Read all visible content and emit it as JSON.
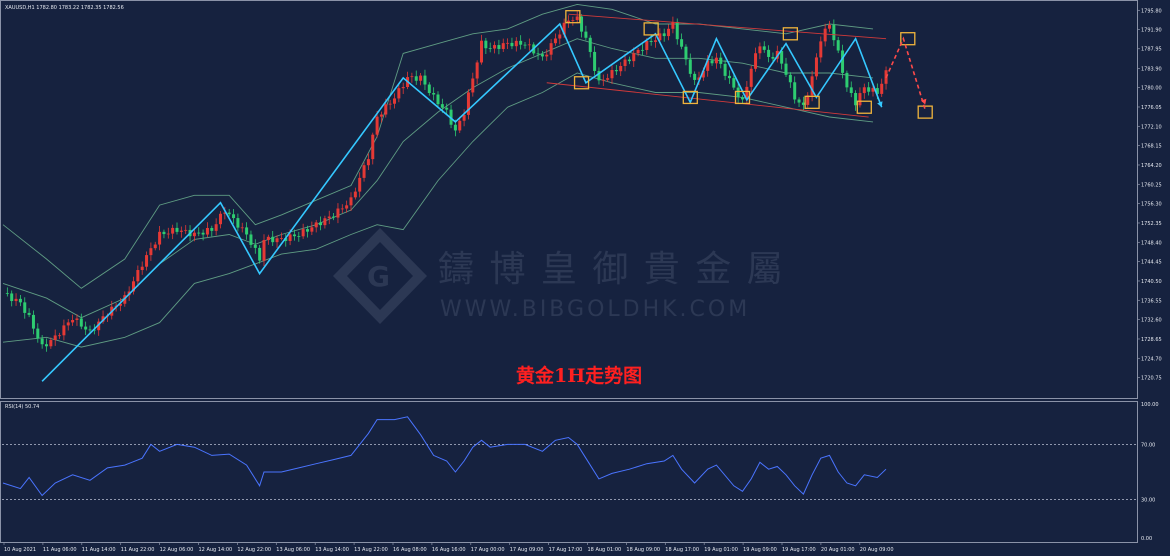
{
  "symbol_header": "XAUUSD,H1  1782.80 1783.22 1782.35 1782.56",
  "rsi_header": "RSI(14) 50.74",
  "annotation": "黄金1H走势图",
  "watermark": {
    "cn": "鑄 博 皇 御 貴 金 屬",
    "url": "WWW.BIBGOLDHK.COM"
  },
  "colors": {
    "background": "#16223f",
    "up": "#e53935",
    "down": "#2ecc71",
    "bollinger": "#5f9c83",
    "zigzag": "#35c8ff",
    "channel": "#d13a3a",
    "box": "#f0b43c",
    "forecast": "#ff4a4a",
    "rsi": "#4a74ff",
    "text": "#e6e9f0"
  },
  "chart_data": [
    {
      "type": "candlestick",
      "title": "",
      "y_ticks": [
        "1795.80",
        "1791.90",
        "1787.95",
        "1783.90",
        "1780.00",
        "1776.05",
        "1772.10",
        "1768.15",
        "1764.20",
        "1760.25",
        "1756.30",
        "1752.35",
        "1748.40",
        "1744.45",
        "1740.50",
        "1736.55",
        "1732.60",
        "1728.65",
        "1724.70",
        "1720.75"
      ],
      "x_ticks": [
        "10 Aug 2021",
        "11 Aug 06:00",
        "11 Aug 14:00",
        "11 Aug 22:00",
        "12 Aug 06:00",
        "12 Aug 14:00",
        "12 Aug 22:00",
        "13 Aug 06:00",
        "13 Aug 14:00",
        "13 Aug 22:00",
        "16 Aug 08:00",
        "16 Aug 16:00",
        "17 Aug 00:00",
        "17 Aug 09:00",
        "17 Aug 17:00",
        "18 Aug 01:00",
        "18 Aug 09:00",
        "18 Aug 17:00",
        "19 Aug 01:00",
        "19 Aug 09:00",
        "19 Aug 17:00",
        "20 Aug 01:00",
        "20 Aug 09:00"
      ],
      "ylim": [
        1717.0,
        1797.5
      ],
      "price_path": [
        [
          0,
          1738
        ],
        [
          4,
          1736
        ],
        [
          6,
          1733
        ],
        [
          9,
          1727
        ],
        [
          12,
          1729
        ],
        [
          16,
          1733
        ],
        [
          20,
          1730
        ],
        [
          24,
          1734
        ],
        [
          28,
          1737
        ],
        [
          32,
          1744
        ],
        [
          36,
          1750
        ],
        [
          40,
          1751
        ],
        [
          44,
          1750
        ],
        [
          48,
          1751
        ],
        [
          51,
          1755
        ],
        [
          52,
          1754
        ],
        [
          56,
          1750
        ],
        [
          59,
          1745
        ],
        [
          60,
          1749
        ],
        [
          64,
          1749
        ],
        [
          68,
          1750
        ],
        [
          72,
          1752
        ],
        [
          76,
          1754
        ],
        [
          80,
          1757
        ],
        [
          84,
          1766
        ],
        [
          86,
          1774
        ],
        [
          90,
          1778
        ],
        [
          93,
          1782
        ],
        [
          96,
          1782
        ],
        [
          99,
          1778
        ],
        [
          102,
          1775
        ],
        [
          104,
          1771
        ],
        [
          106,
          1775
        ],
        [
          108,
          1782
        ],
        [
          110,
          1789
        ],
        [
          112,
          1788
        ],
        [
          116,
          1789
        ],
        [
          120,
          1789
        ],
        [
          124,
          1786
        ],
        [
          127,
          1790
        ],
        [
          130,
          1794
        ],
        [
          132,
          1794
        ],
        [
          134,
          1790
        ],
        [
          137,
          1781
        ],
        [
          140,
          1783
        ],
        [
          144,
          1786
        ],
        [
          148,
          1789
        ],
        [
          152,
          1791
        ],
        [
          154,
          1793
        ],
        [
          156,
          1788
        ],
        [
          159,
          1781
        ],
        [
          162,
          1785
        ],
        [
          164,
          1786
        ],
        [
          168,
          1780
        ],
        [
          170,
          1777
        ],
        [
          172,
          1784
        ],
        [
          174,
          1789
        ],
        [
          176,
          1786
        ],
        [
          178,
          1787
        ],
        [
          180,
          1783
        ],
        [
          182,
          1778
        ],
        [
          184,
          1776
        ],
        [
          186,
          1782
        ],
        [
          188,
          1790
        ],
        [
          190,
          1793
        ],
        [
          192,
          1787
        ],
        [
          194,
          1780
        ],
        [
          196,
          1777
        ],
        [
          198,
          1780
        ],
        [
          201,
          1779
        ],
        [
          203,
          1783
        ]
      ],
      "bollinger": {
        "upper": [
          [
            0,
            1752
          ],
          [
            10,
            1745
          ],
          [
            18,
            1739
          ],
          [
            28,
            1745
          ],
          [
            36,
            1756
          ],
          [
            44,
            1758
          ],
          [
            52,
            1758
          ],
          [
            58,
            1752
          ],
          [
            64,
            1754
          ],
          [
            72,
            1757
          ],
          [
            80,
            1760
          ],
          [
            86,
            1770
          ],
          [
            92,
            1787
          ],
          [
            100,
            1789
          ],
          [
            108,
            1791
          ],
          [
            116,
            1792
          ],
          [
            124,
            1795
          ],
          [
            132,
            1797
          ],
          [
            140,
            1796
          ],
          [
            150,
            1793
          ],
          [
            160,
            1793
          ],
          [
            170,
            1792
          ],
          [
            180,
            1791
          ],
          [
            190,
            1793
          ],
          [
            200,
            1792
          ]
        ],
        "middle": [
          [
            0,
            1740
          ],
          [
            10,
            1737
          ],
          [
            18,
            1733
          ],
          [
            28,
            1737
          ],
          [
            36,
            1744
          ],
          [
            44,
            1749
          ],
          [
            52,
            1750
          ],
          [
            58,
            1748
          ],
          [
            64,
            1750
          ],
          [
            72,
            1752
          ],
          [
            80,
            1755
          ],
          [
            86,
            1761
          ],
          [
            92,
            1769
          ],
          [
            100,
            1775
          ],
          [
            108,
            1780
          ],
          [
            116,
            1784
          ],
          [
            124,
            1787
          ],
          [
            132,
            1790
          ],
          [
            140,
            1788
          ],
          [
            150,
            1786
          ],
          [
            160,
            1786
          ],
          [
            170,
            1785
          ],
          [
            180,
            1783
          ],
          [
            190,
            1783
          ],
          [
            200,
            1782
          ]
        ],
        "lower": [
          [
            0,
            1728
          ],
          [
            10,
            1729
          ],
          [
            18,
            1727
          ],
          [
            28,
            1729
          ],
          [
            36,
            1732
          ],
          [
            44,
            1740
          ],
          [
            52,
            1742
          ],
          [
            58,
            1744
          ],
          [
            64,
            1746
          ],
          [
            72,
            1747
          ],
          [
            80,
            1750
          ],
          [
            86,
            1752
          ],
          [
            92,
            1751
          ],
          [
            100,
            1761
          ],
          [
            108,
            1769
          ],
          [
            116,
            1776
          ],
          [
            124,
            1779
          ],
          [
            132,
            1783
          ],
          [
            140,
            1781
          ],
          [
            150,
            1779
          ],
          [
            160,
            1779
          ],
          [
            170,
            1778
          ],
          [
            180,
            1776
          ],
          [
            190,
            1774
          ],
          [
            200,
            1773
          ]
        ]
      },
      "zigzag": [
        [
          9,
          1720
        ],
        [
          50,
          1756.5
        ],
        [
          59,
          1742
        ],
        [
          92,
          1782
        ],
        [
          104,
          1773
        ],
        [
          128,
          1793
        ],
        [
          134,
          1781
        ],
        [
          150,
          1791
        ],
        [
          158,
          1777
        ],
        [
          164,
          1790
        ],
        [
          171,
          1777.5
        ],
        [
          180,
          1789
        ],
        [
          187,
          1778
        ],
        [
          196,
          1790
        ],
        [
          202,
          1776
        ]
      ],
      "channel": {
        "upper": [
          [
            130,
            1795
          ],
          [
            203,
            1790
          ]
        ],
        "lower": [
          [
            125,
            1781
          ],
          [
            199,
            1774
          ]
        ]
      },
      "markers": [
        [
          131,
          1794.5
        ],
        [
          149,
          1792
        ],
        [
          158,
          1778
        ],
        [
          133,
          1781
        ],
        [
          170,
          1778
        ],
        [
          181,
          1791
        ],
        [
          186,
          1777
        ],
        [
          208,
          1790
        ],
        [
          198,
          1776
        ],
        [
          212,
          1775
        ]
      ],
      "forecast": [
        [
          203,
          1782
        ],
        [
          207,
          1790
        ],
        [
          212,
          1775.5
        ]
      ]
    },
    {
      "type": "line",
      "name": "RSI(14)",
      "ylim": [
        0,
        100
      ],
      "y_ticks": [
        100,
        70,
        30,
        0
      ],
      "levels": [
        70,
        30
      ],
      "values": [
        [
          0,
          42
        ],
        [
          4,
          38
        ],
        [
          6,
          46
        ],
        [
          9,
          33
        ],
        [
          12,
          42
        ],
        [
          16,
          48
        ],
        [
          20,
          44
        ],
        [
          24,
          53
        ],
        [
          28,
          55
        ],
        [
          32,
          60
        ],
        [
          34,
          70
        ],
        [
          36,
          65
        ],
        [
          40,
          70
        ],
        [
          44,
          68
        ],
        [
          48,
          62
        ],
        [
          52,
          63
        ],
        [
          56,
          55
        ],
        [
          59,
          40
        ],
        [
          60,
          50
        ],
        [
          64,
          50
        ],
        [
          68,
          53
        ],
        [
          72,
          56
        ],
        [
          76,
          59
        ],
        [
          80,
          62
        ],
        [
          84,
          78
        ],
        [
          86,
          88
        ],
        [
          90,
          88
        ],
        [
          93,
          90
        ],
        [
          96,
          77
        ],
        [
          99,
          62
        ],
        [
          102,
          58
        ],
        [
          104,
          50
        ],
        [
          106,
          58
        ],
        [
          108,
          68
        ],
        [
          110,
          73
        ],
        [
          112,
          68
        ],
        [
          116,
          70
        ],
        [
          120,
          70
        ],
        [
          124,
          65
        ],
        [
          127,
          73
        ],
        [
          130,
          75
        ],
        [
          132,
          70
        ],
        [
          134,
          60
        ],
        [
          137,
          45
        ],
        [
          140,
          49
        ],
        [
          144,
          52
        ],
        [
          148,
          56
        ],
        [
          152,
          58
        ],
        [
          154,
          62
        ],
        [
          156,
          52
        ],
        [
          159,
          42
        ],
        [
          162,
          52
        ],
        [
          164,
          55
        ],
        [
          168,
          40
        ],
        [
          170,
          36
        ],
        [
          172,
          45
        ],
        [
          174,
          57
        ],
        [
          176,
          52
        ],
        [
          178,
          54
        ],
        [
          180,
          48
        ],
        [
          182,
          40
        ],
        [
          184,
          34
        ],
        [
          186,
          48
        ],
        [
          188,
          60
        ],
        [
          190,
          62
        ],
        [
          192,
          50
        ],
        [
          194,
          42
        ],
        [
          196,
          40
        ],
        [
          198,
          48
        ],
        [
          201,
          46
        ],
        [
          203,
          52
        ]
      ]
    }
  ]
}
